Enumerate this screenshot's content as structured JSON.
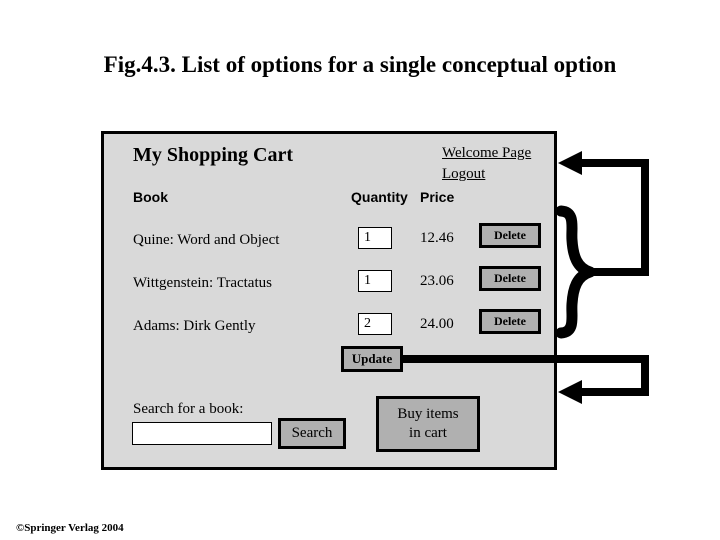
{
  "figure": {
    "title": "Fig.4.3. List of options for a single conceptual option",
    "footer": "©Springer Verlag 2004"
  },
  "app": {
    "cart_title": "My Shopping Cart",
    "nav": [
      {
        "label": "Welcome Page",
        "name": "welcome-page-link"
      },
      {
        "label": "Logout",
        "name": "logout-link"
      }
    ],
    "columns": {
      "book": "Book",
      "quantity": "Quantity",
      "price": "Price"
    },
    "rows": [
      {
        "title": "Quine: Word and Object",
        "quantity": "1",
        "price": "12.46",
        "delete_label": "Delete"
      },
      {
        "title": "Wittgenstein: Tractatus",
        "quantity": "1",
        "price": "23.06",
        "delete_label": "Delete"
      },
      {
        "title": "Adams: Dirk Gently",
        "quantity": "2",
        "price": "24.00",
        "delete_label": "Delete"
      }
    ],
    "update_label": "Update",
    "search": {
      "label": "Search for a book:",
      "value": "",
      "placeholder": "",
      "button_label": "Search"
    },
    "buy": {
      "line1": "Buy items",
      "line2": "in cart"
    }
  },
  "colors": {
    "panel_background": "#d9d9d9",
    "button_face": "#b0b0b0",
    "border": "#000000",
    "input_background": "#ffffff",
    "page_background": "#ffffff",
    "text": "#000000"
  }
}
